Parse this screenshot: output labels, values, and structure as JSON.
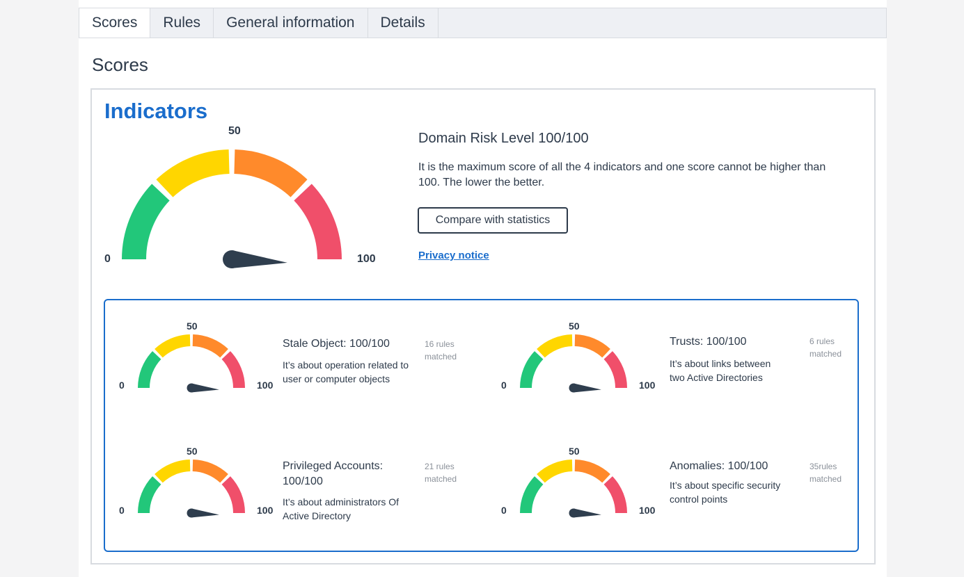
{
  "tabs": [
    {
      "label": "Scores",
      "active": true
    },
    {
      "label": "Rules",
      "active": false
    },
    {
      "label": "General information",
      "active": false
    },
    {
      "label": "Details",
      "active": false
    }
  ],
  "section_title": "Scores",
  "panel_title": "Indicators",
  "gauge_colors": {
    "green": "#22c77a",
    "yellow": "#ffd600",
    "orange": "#ff8a2b",
    "red": "#f04f6a",
    "needle": "#2f3e4e"
  },
  "main_gauge": {
    "min_label": "0",
    "mid_label": "50",
    "max_label": "100",
    "value": 100
  },
  "risk": {
    "title": "Domain Risk Level 100/100",
    "description": "It is the maximum score of all the 4 indicators and one score cannot be higher than 100. The lower the better.",
    "compare_label": "Compare with statistics",
    "privacy_label": "Privacy notice"
  },
  "indicators": [
    {
      "title": "Stale Object: 100/100",
      "description": "It’s about operation related to user or computer objects",
      "rules": "16 rules matched",
      "min_label": "0",
      "mid_label": "50",
      "max_label": "100",
      "value": 100
    },
    {
      "title": "Trusts: 100/100",
      "description": "It’s about links between two Active  Directories",
      "rules": "6 rules matched",
      "min_label": "0",
      "mid_label": "50",
      "max_label": "100",
      "value": 100
    },
    {
      "title": "Privileged Accounts: 100/100",
      "description": "It’s about administrators Of Active Directory",
      "rules": "21 rules matched",
      "min_label": "0",
      "mid_label": "50",
      "max_label": "100",
      "value": 100
    },
    {
      "title": "Anomalies: 100/100",
      "description": "It’s about specific security control points",
      "rules": "35rules matched",
      "min_label": "0",
      "mid_label": "50",
      "max_label": "100",
      "value": 100
    }
  ]
}
